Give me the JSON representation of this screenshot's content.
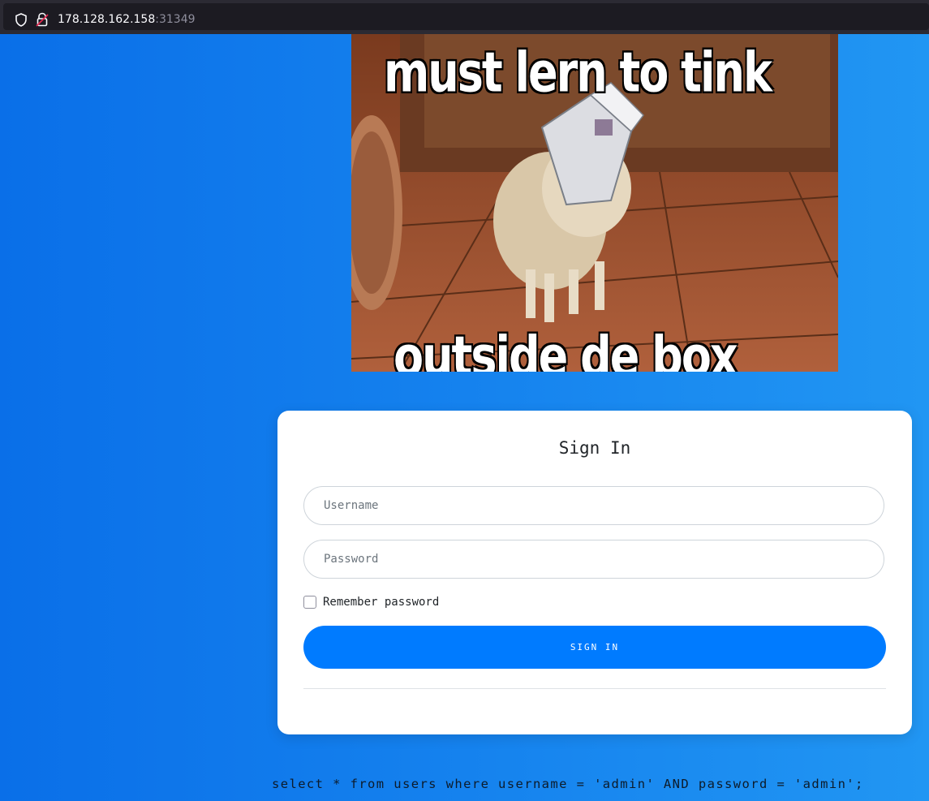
{
  "browser": {
    "url_host": "178.128.162.158",
    "url_port": ":31349",
    "icons": [
      "shield-icon",
      "lock-warning-icon"
    ]
  },
  "meme": {
    "top_text": "must lern to tink",
    "bottom_text": "outside de box"
  },
  "login": {
    "title": "Sign In",
    "username_placeholder": "Username",
    "password_placeholder": "Password",
    "remember_label": "Remember password",
    "submit_label": "SIGN IN",
    "accent_color": "#007bff"
  },
  "debug": {
    "query": "select * from users where username = 'admin' AND password = 'admin';"
  }
}
